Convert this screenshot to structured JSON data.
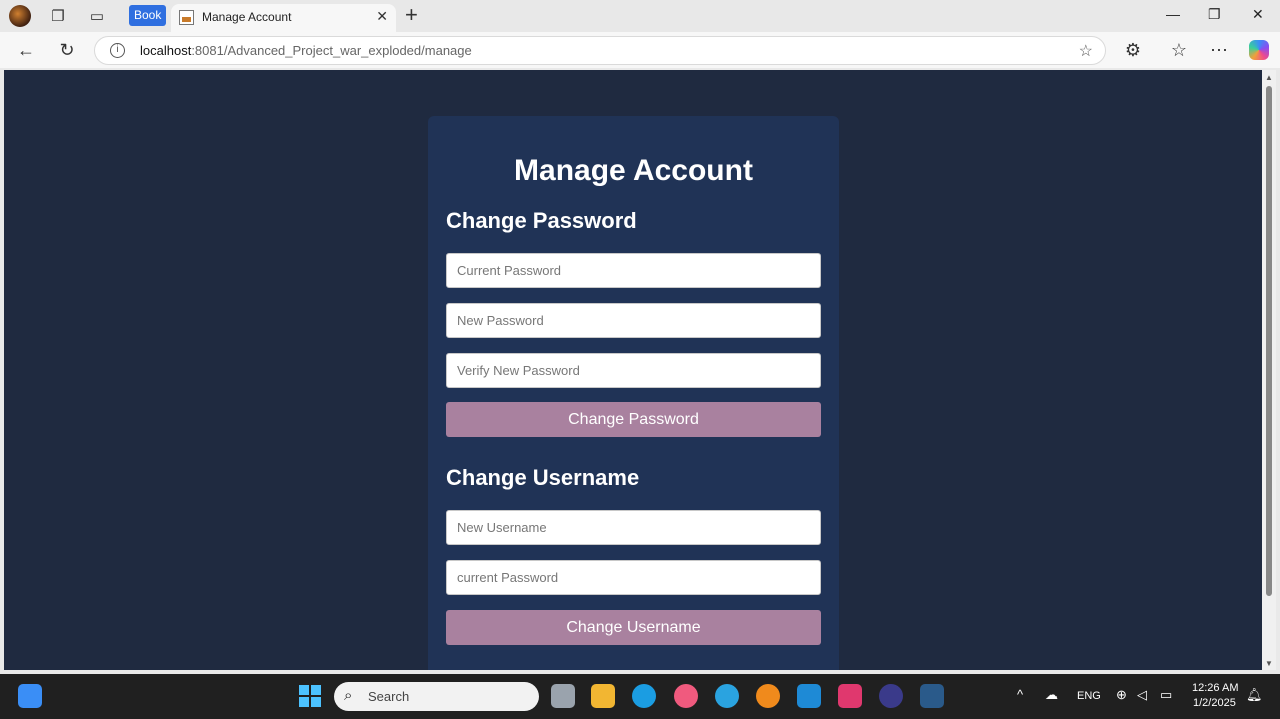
{
  "browser": {
    "pinned_chip": "Book",
    "tab_title": "Manage Account",
    "url_host": "localhost",
    "url_rest": ":8081/Advanced_Project_war_exploded/manage"
  },
  "page": {
    "heading": "Manage Account",
    "password_section": {
      "title": "Change Password",
      "current_placeholder": "Current Password",
      "new_placeholder": "New Password",
      "verify_placeholder": "Verify New Password",
      "submit_label": "Change Password"
    },
    "username_section": {
      "title": "Change Username",
      "new_username_placeholder": "New Username",
      "password_placeholder": "current Password",
      "submit_label": "Change Username"
    }
  },
  "taskbar": {
    "search_placeholder": "Search",
    "language": "ENG",
    "time": "12:26 AM",
    "date": "1/2/2025"
  },
  "colors": {
    "page_bg": "#1f2a40",
    "card_bg": "#203356",
    "button_bg": "#a9819f"
  }
}
